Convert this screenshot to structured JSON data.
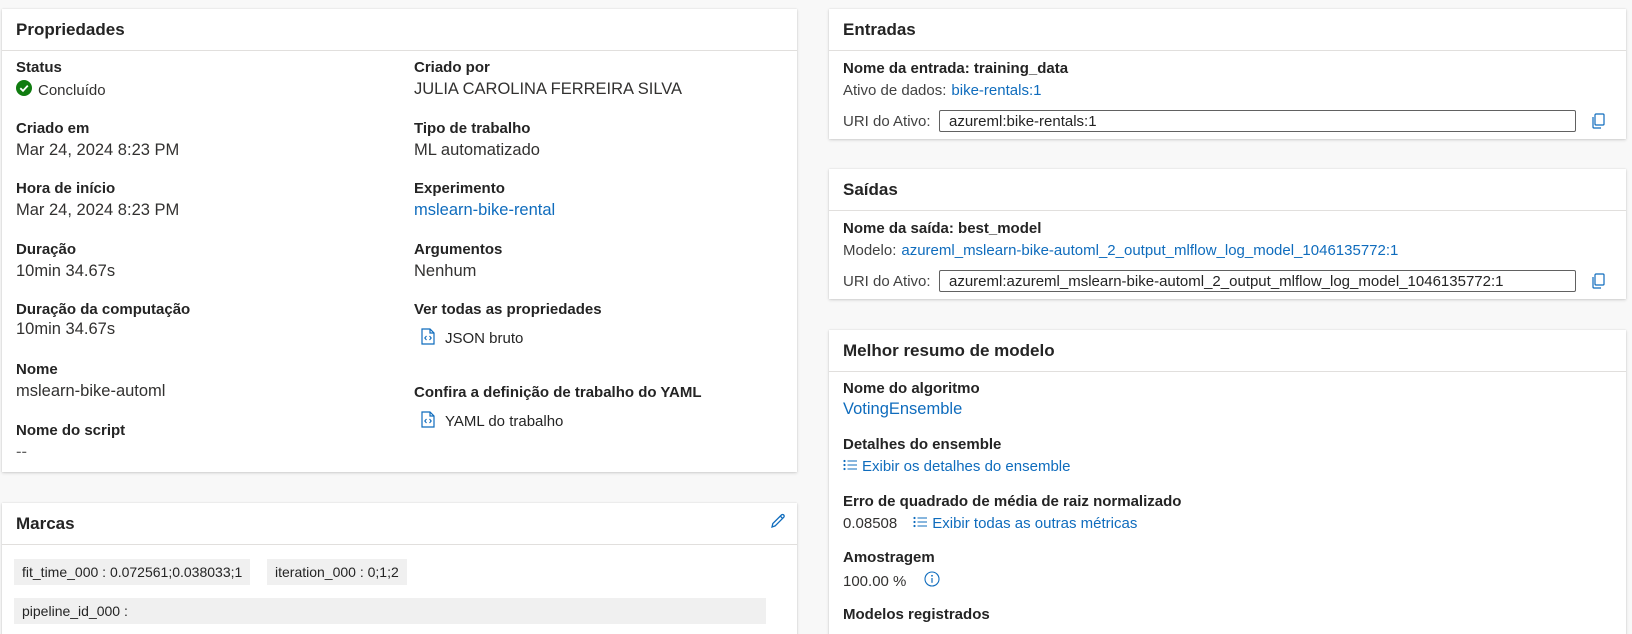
{
  "properties": {
    "title": "Propriedades",
    "status_label": "Status",
    "status_value": "Concluído",
    "created_on_label": "Criado em",
    "created_on_value": "Mar 24, 2024 8:23 PM",
    "start_time_label": "Hora de início",
    "start_time_value": "Mar 24, 2024 8:23 PM",
    "duration_label": "Duração",
    "duration_value": "10min 34.67s",
    "compute_duration_label": "Duração da computação",
    "compute_duration_value": "10min 34.67s",
    "name_label": "Nome",
    "name_value": "mslearn-bike-automl",
    "script_name_label": "Nome do script",
    "script_name_value": "--",
    "created_by_label": "Criado por",
    "created_by_value": "JULIA CAROLINA FERREIRA SILVA",
    "job_type_label": "Tipo de trabalho",
    "job_type_value": "ML automatizado",
    "experiment_label": "Experimento",
    "experiment_value": "mslearn-bike-rental",
    "arguments_label": "Argumentos",
    "arguments_value": "Nenhum",
    "view_all_label": "Ver todas as propriedades",
    "raw_json_label": "JSON bruto",
    "yaml_def_label": "Confira a definição de trabalho do YAML",
    "yaml_job_label": "YAML do trabalho"
  },
  "tags": {
    "title": "Marcas",
    "items": [
      "fit_time_000 : 0.072561;0.038033;1",
      "iteration_000 : 0;1;2",
      "pipeline_id_000 :"
    ]
  },
  "inputs": {
    "title": "Entradas",
    "input_name_label": "Nome da entrada: training_data",
    "data_asset_label": "Ativo de dados:",
    "data_asset_link": "bike-rentals:1",
    "uri_label": "URI do Ativo:",
    "uri_value": "azureml:bike-rentals:1"
  },
  "outputs": {
    "title": "Saídas",
    "output_name_label": "Nome da saída: best_model",
    "model_label": "Modelo:",
    "model_link": "azureml_mslearn-bike-automl_2_output_mlflow_log_model_1046135772:1",
    "uri_label": "URI do Ativo:",
    "uri_value": "azureml:azureml_mslearn-bike-automl_2_output_mlflow_log_model_1046135772:1"
  },
  "best_model": {
    "title": "Melhor resumo de modelo",
    "algorithm_label": "Nome do algoritmo",
    "algorithm_value": "VotingEnsemble",
    "ensemble_details_label": "Detalhes do ensemble",
    "ensemble_details_link": "Exibir os detalhes do ensemble",
    "nrmse_label": "Erro de quadrado de média de raiz normalizado",
    "nrmse_value": "0.08508",
    "all_metrics_link": "Exibir todas as outras métricas",
    "sampling_label": "Amostragem",
    "sampling_value": "100.00 %",
    "registered_models_label": "Modelos registrados"
  },
  "colors": {
    "accent": "#0f6cbd",
    "success": "#107c10"
  }
}
